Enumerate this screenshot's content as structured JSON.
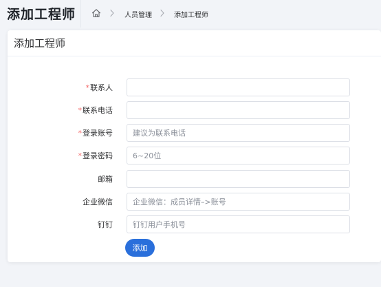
{
  "header": {
    "page_title": "添加工程师",
    "breadcrumb": {
      "home_icon": "home-icon",
      "separator_icon": "chevron-right-icon",
      "items": [
        "人员管理",
        "添加工程师"
      ]
    }
  },
  "card": {
    "title": "添加工程师"
  },
  "form": {
    "required_mark": "*",
    "fields": [
      {
        "label": "联系人",
        "required": true,
        "value": "",
        "placeholder": ""
      },
      {
        "label": "联系电话",
        "required": true,
        "value": "",
        "placeholder": ""
      },
      {
        "label": "登录账号",
        "required": true,
        "value": "",
        "placeholder": "建议为联系电话"
      },
      {
        "label": "登录密码",
        "required": true,
        "value": "",
        "placeholder": "6~20位"
      },
      {
        "label": "邮箱",
        "required": false,
        "value": "",
        "placeholder": ""
      },
      {
        "label": "企业微信",
        "required": false,
        "value": "",
        "placeholder": "企业微信：成员详情–>账号"
      },
      {
        "label": "钉钉",
        "required": false,
        "value": "",
        "placeholder": "钉钉用户手机号"
      }
    ],
    "submit_label": "添加"
  },
  "colors": {
    "accent": "#2a6fdb",
    "required": "#f56c6c",
    "background": "#f2f4f8"
  }
}
